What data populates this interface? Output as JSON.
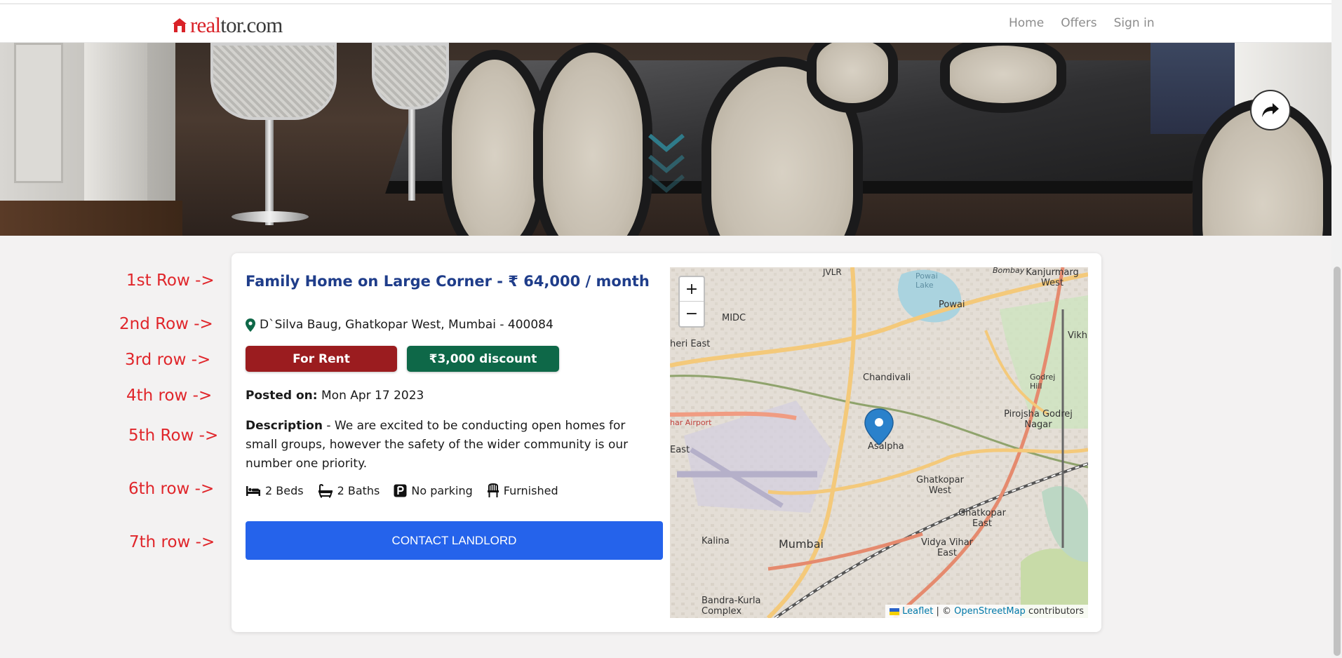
{
  "header": {
    "logo_text_a": "real",
    "logo_text_b": "tor.com",
    "nav": [
      "Home",
      "Offers",
      "Sign in"
    ]
  },
  "row_labels": [
    "1st Row ->",
    "2nd Row ->",
    "3rd row ->",
    "4th row ->",
    "5th Row ->",
    "6th row ->",
    "7th row ->"
  ],
  "listing": {
    "title": "Family Home on Large Corner - ₹ 64,000 / month",
    "address": "D`Silva Baug, Ghatkopar West, Mumbai - 400084",
    "badge_rent": "For Rent",
    "badge_discount": "₹3,000 discount",
    "posted_label": "Posted on:",
    "posted_date": "Mon Apr 17 2023",
    "description_label": "Description",
    "description_text": " - We are excited to be conducting open homes for small groups, however the safety of the wider community is our number one priority.",
    "features": {
      "beds": "2 Beds",
      "baths": "2 Baths",
      "parking": "No parking",
      "furnished": "Furnished"
    },
    "contact_button": "CONTACT LANDLORD"
  },
  "map": {
    "zoom_in": "+",
    "zoom_out": "−",
    "attribution_leaflet": "Leaflet",
    "attribution_sep": " | © ",
    "attribution_osm": "OpenStreetMap",
    "attribution_suffix": " contributors",
    "labels": [
      "JVLR",
      "Powai Lake",
      "Bombay",
      "Kanjurmarg West",
      "MIDC",
      "Powai",
      "Vikh",
      "heri East",
      "Chandivali",
      "Godrej Hill",
      "Pirojsha Godrej Nagar",
      "har Airport",
      "Asalpha",
      "East",
      "Ghatkopar West",
      "Ghatkopar East",
      "Kalina",
      "Mumbai",
      "Vidya Vihar East",
      "Bandra-Kurla Complex"
    ]
  },
  "colors": {
    "title": "#1f3d8a",
    "rent": "#9b1c1f",
    "discount": "#0e6848",
    "button": "#2563eb",
    "row_label": "#e0262b",
    "brand": "#d92228"
  }
}
